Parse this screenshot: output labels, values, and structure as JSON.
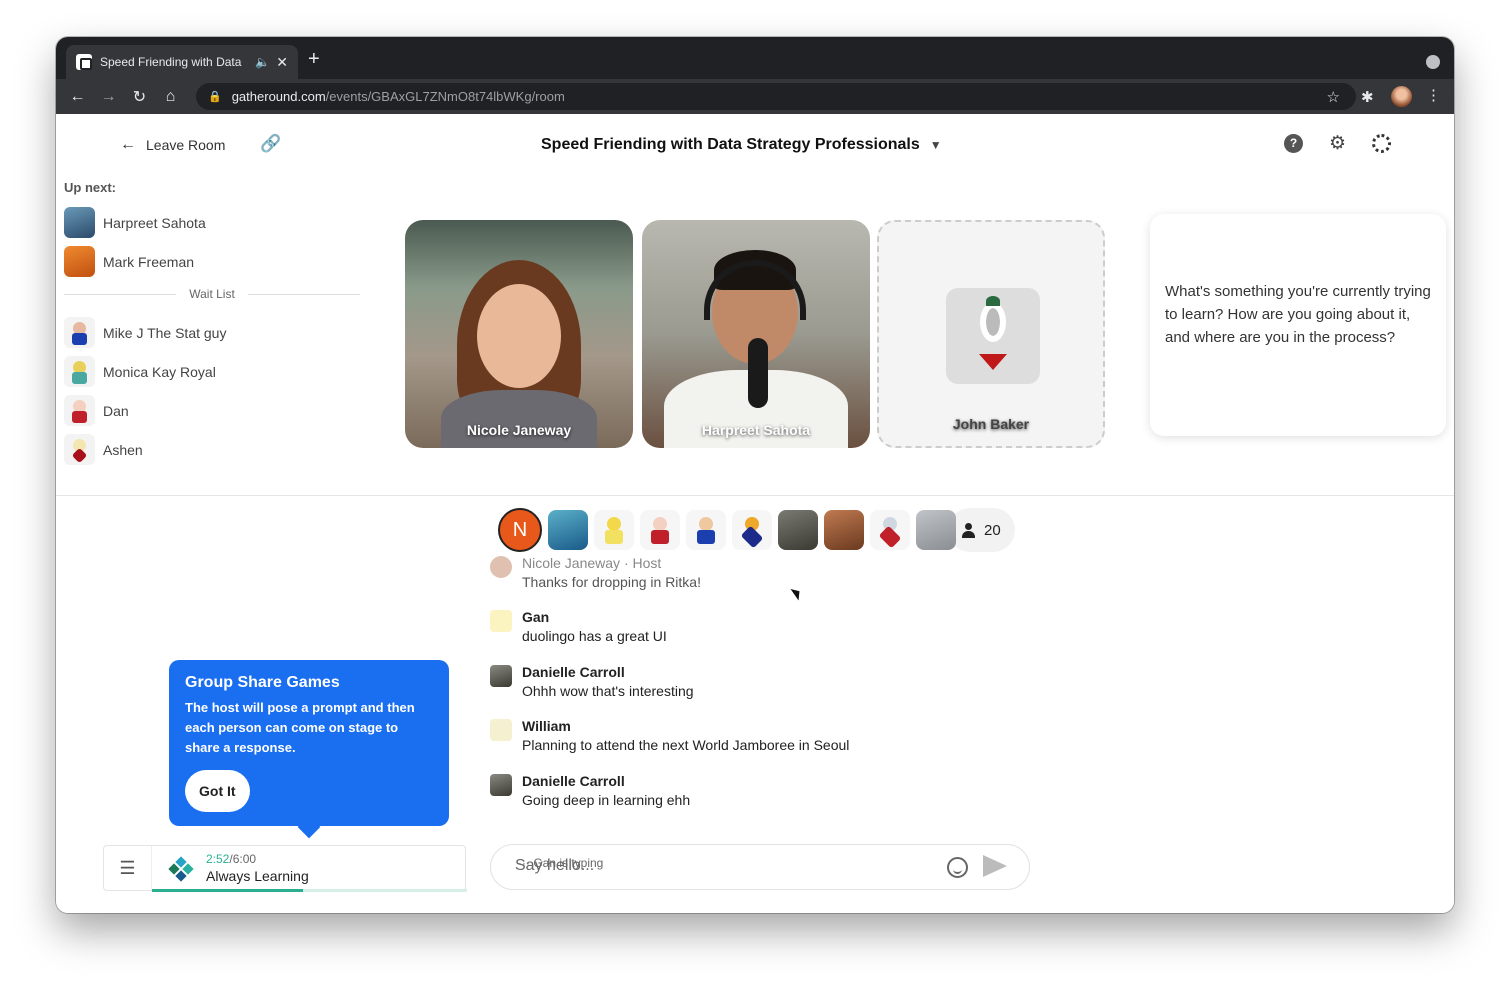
{
  "browser": {
    "tab_title": "Speed Friending with Data",
    "url_host": "gatheround.com",
    "url_path": "/events/GBAxGL7ZNmO8t74lbWKg/room"
  },
  "header": {
    "leave_label": "Leave Room",
    "event_title": "Speed Friending with Data Strategy Professionals"
  },
  "sidebar": {
    "upnext_label": "Up next:",
    "upnext": [
      {
        "name": "Harpreet Sahota"
      },
      {
        "name": "Mark Freeman"
      }
    ],
    "waitlist_label": "Wait List",
    "waitlist": [
      {
        "name": "Mike J The Stat guy"
      },
      {
        "name": "Monica Kay Royal"
      },
      {
        "name": "Dan"
      },
      {
        "name": "Ashen"
      }
    ]
  },
  "stage": {
    "tiles": [
      {
        "name": "Nicole Janeway"
      },
      {
        "name": "Harpreet Sahota"
      },
      {
        "name": "John Baker"
      }
    ],
    "prompt": "What's something you're currently trying to learn? How are you going about it, and where are you in the process?"
  },
  "audience": {
    "first_initial": "N",
    "count": "20"
  },
  "chat": {
    "messages": [
      {
        "author": "Nicole Janeway · Host",
        "text": "Thanks for dropping in Ritka!"
      },
      {
        "author": "Gan",
        "text": "duolingo has a great UI"
      },
      {
        "author": "Danielle Carroll",
        "text": "Ohhh wow that's interesting"
      },
      {
        "author": "William",
        "text": "Planning to attend the next World Jamboree in Seoul"
      },
      {
        "author": "Danielle Carroll",
        "text": "Going deep in learning ehh"
      }
    ],
    "typing": "··· Gan is typing",
    "input_placeholder": "Say hello..."
  },
  "tooltip": {
    "title": "Group Share Games",
    "body": "The host will pose a prompt and then each person can come on stage to share a response.",
    "button": "Got It"
  },
  "now_playing": {
    "elapsed": "2:52",
    "total": "/6:00",
    "game": "Always Learning",
    "progress": 0.48
  },
  "colors": {
    "accent": "#1a6ef0",
    "progress": "#2ab090",
    "host_avatar": "#e8581a"
  }
}
